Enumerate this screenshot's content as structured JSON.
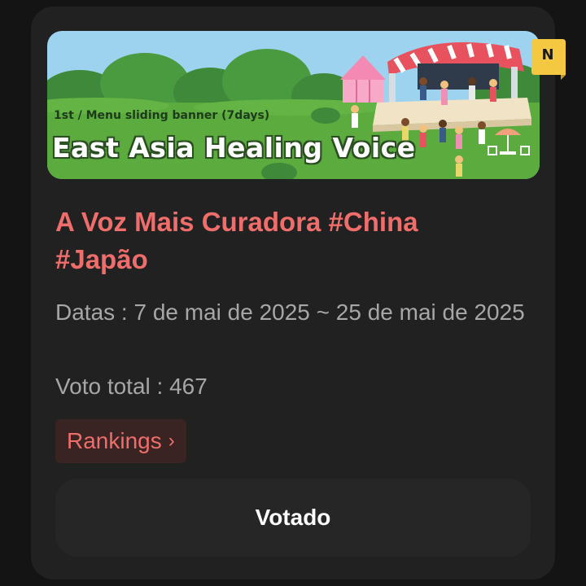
{
  "banner": {
    "subtitle": "1st / Menu sliding banner (7days)",
    "title": "East Asia Healing Voice",
    "badge_letter": "N",
    "colors": {
      "sky": "#9ed3f0",
      "grass": "#5cab3f",
      "stage_canopy": "#e8515e",
      "tent": "#f48ab3"
    }
  },
  "event": {
    "title": "A Voz Mais Curadora #China #Japão",
    "dates": "Datas : 7 de mai de 2025 ~ 25 de mai de 2025",
    "total_votes": "Voto total : 467"
  },
  "actions": {
    "rankings_label": "Rankings",
    "rankings_icon": "chevron-right-icon",
    "vote_label": "Votado"
  },
  "theme": {
    "background": "#141414",
    "card": "#212121",
    "accent": "#ef6d6a",
    "muted_text": "#a7a7a7"
  }
}
